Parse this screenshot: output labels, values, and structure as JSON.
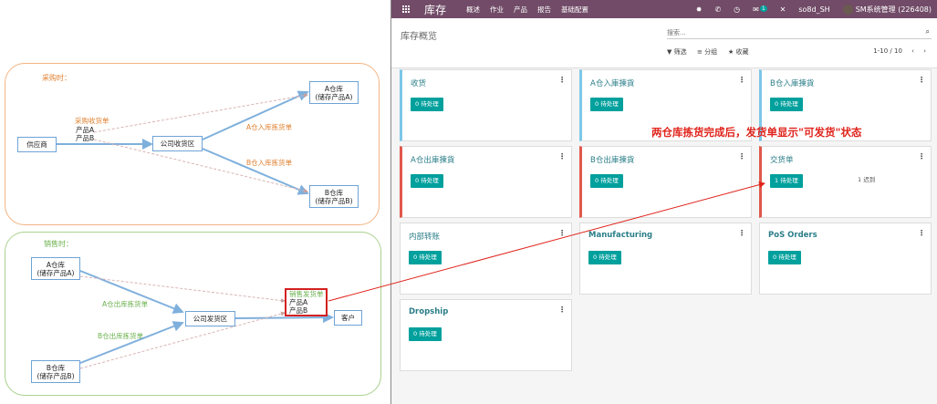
{
  "diagram": {
    "purchase": {
      "title": "采购时：",
      "supplier": "供应商",
      "receipt_zone": "公司收货区",
      "warehouse_a": [
        "A仓库",
        "(储存产品A)"
      ],
      "warehouse_b": [
        "B仓库",
        "(储存产品B)"
      ],
      "purchase_receipt": "采购收货单",
      "product_a": "产品A",
      "product_b": "产品B",
      "a_putaway": "A仓入库拣货单",
      "b_putaway": "B仓入库拣货单"
    },
    "sales": {
      "title": "销售时：",
      "warehouse_a": [
        "A仓库",
        "(储存产品A)"
      ],
      "warehouse_b": [
        "B仓库",
        "(储存产品B)"
      ],
      "shipping_zone": "公司发货区",
      "a_outbound": "A仓出库拣货单",
      "b_outbound": "B仓出库拣货单",
      "sales_delivery": "销售发货单",
      "product_a": "产品A",
      "product_b": "产品B",
      "customer": "客户"
    }
  },
  "app": {
    "brand": "库存",
    "menu": [
      "概述",
      "作业",
      "产品",
      "报告",
      "基础配置"
    ],
    "chat_badge": "1",
    "company": "so8d_SH",
    "user": "SM系统管理 (226408)",
    "breadcrumb": "库存概览",
    "search_placeholder": "搜索...",
    "filter_label": "筛选",
    "group_label": "分组",
    "favorite_label": "收藏",
    "pager": "1-10 / 10",
    "cards": [
      {
        "title": "收货",
        "button": "0 待处理",
        "late": ""
      },
      {
        "title": "A仓入庫揀貨",
        "button": "0 待处理",
        "late": ""
      },
      {
        "title": "B仓入庫揀貨",
        "button": "0 待处理",
        "late": ""
      },
      {
        "title": "A仓出庫揀貨",
        "button": "0 待处理",
        "late": ""
      },
      {
        "title": "B仓出庫揀貨",
        "button": "0 待处理",
        "late": ""
      },
      {
        "title": "交货单",
        "button": "1 待处理",
        "late": "1 迟到"
      },
      {
        "title": "内部转账",
        "button": "0 待处理",
        "late": ""
      },
      {
        "title": "Manufacturing",
        "button": "0 待处理",
        "late": ""
      },
      {
        "title": "PoS Orders",
        "button": "0 待处理",
        "late": ""
      },
      {
        "title": "Dropship",
        "button": "0 待处理",
        "late": ""
      }
    ]
  },
  "annotation": "两仓库拣货完成后，发货单显示\"可发货\"状态",
  "colors": {
    "navbar": "#714b67",
    "teal_button": "#00a09d",
    "card_title": "#2a7e88",
    "annotation_red": "#e0231b",
    "purchase_border": "#f4b483",
    "sales_border": "#a9d18e"
  }
}
